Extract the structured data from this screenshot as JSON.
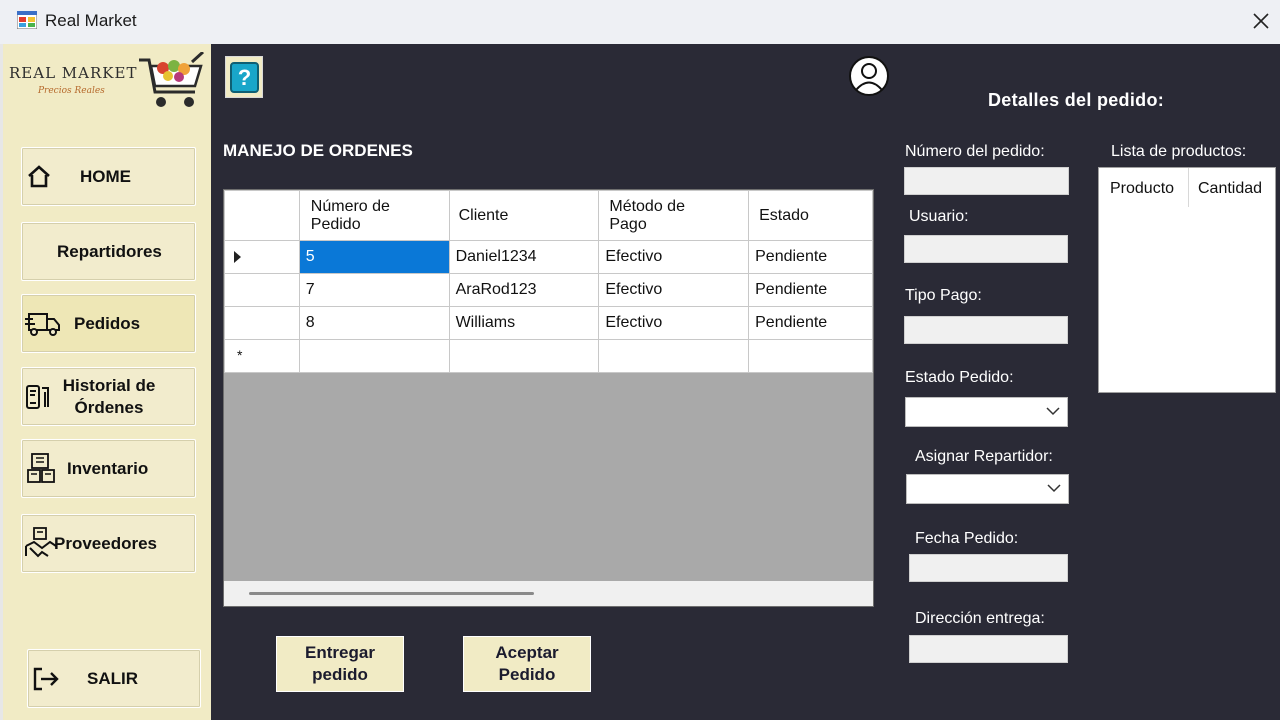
{
  "window": {
    "title": "Real Market"
  },
  "logo": {
    "name": "REAL MARKET",
    "tagline": "Precios Reales"
  },
  "sidebar": {
    "items": [
      {
        "label": "HOME",
        "icon": "home-icon"
      },
      {
        "label": "Repartidores",
        "icon": ""
      },
      {
        "label": "Pedidos",
        "icon": "delivery-truck-icon",
        "active": true
      },
      {
        "label_line1": "Historial de",
        "label_line2": "Órdenes",
        "icon": "order-history-icon"
      },
      {
        "label": "Inventario",
        "icon": "inventory-icon"
      },
      {
        "label": "Proveedores",
        "icon": "suppliers-handshake-icon"
      }
    ],
    "exit_label": "SALIR"
  },
  "main": {
    "section_title": "MANEJO DE ORDENES",
    "details_title": "Detalles del pedido:"
  },
  "grid": {
    "columns": [
      {
        "line1": "Número de",
        "line2": "Pedido"
      },
      {
        "line1": "Cliente",
        "line2": ""
      },
      {
        "line1": "Método de",
        "line2": "Pago"
      },
      {
        "line1": "Estado",
        "line2": ""
      }
    ],
    "rows": [
      [
        "5",
        "Daniel1234",
        "Efectivo",
        "Pendiente"
      ],
      [
        "7",
        "AraRod123",
        "Efectivo",
        "Pendiente"
      ],
      [
        "8",
        "Williams",
        "Efectivo",
        "Pendiente"
      ]
    ],
    "new_row_marker": "*"
  },
  "buttons": {
    "deliver": {
      "line1": "Entregar",
      "line2": "pedido"
    },
    "accept": {
      "line1": "Aceptar",
      "line2": "Pedido"
    }
  },
  "form": {
    "order_number_label": "Número del pedido:",
    "user_label": "Usuario:",
    "payment_type_label": "Tipo Pago:",
    "order_status_label": "Estado Pedido:",
    "assign_courier_label": "Asignar Repartidor:",
    "order_date_label": "Fecha Pedido:",
    "delivery_address_label": "Dirección entrega:",
    "product_list_label": "Lista de productos:",
    "product_list_columns": [
      "Producto",
      "Cantidad"
    ]
  },
  "colors": {
    "main_bg": "#2a2a36",
    "sidebar_bg": "#f1ebc5",
    "selection": "#0a78d7",
    "help_icon": "#19a6c9"
  }
}
